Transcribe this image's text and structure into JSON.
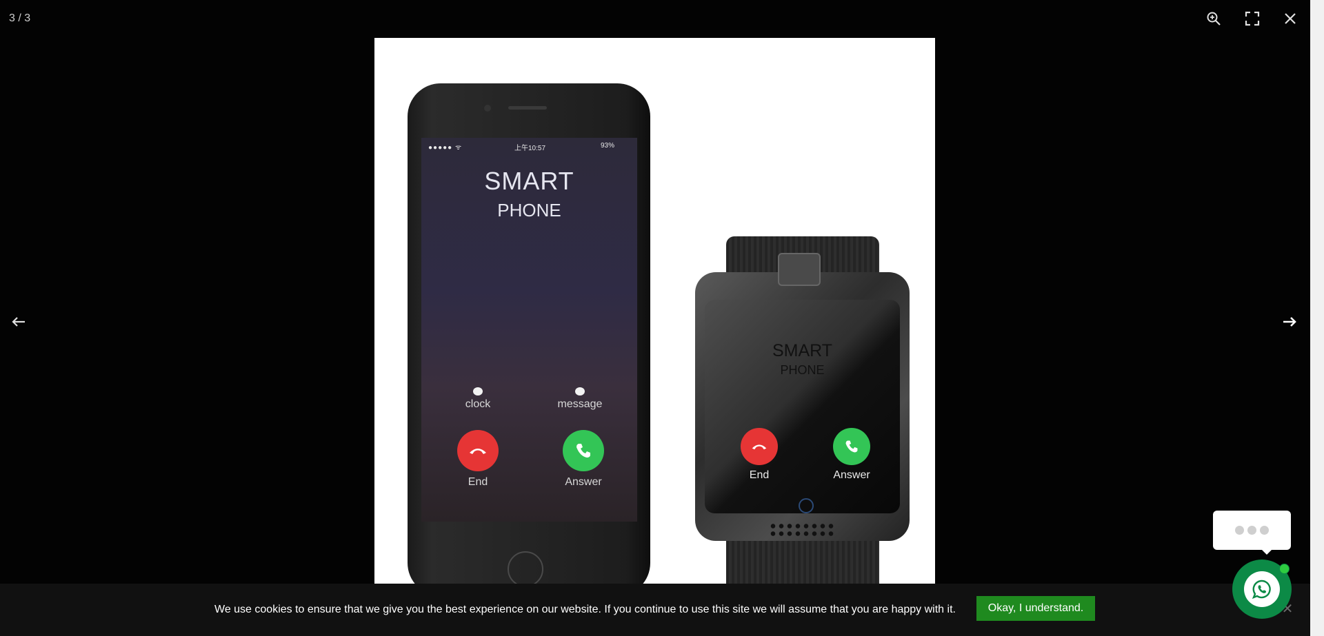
{
  "viewer": {
    "counter": "3 / 3",
    "toolbar": {
      "zoom": "zoom-in-icon",
      "fullscreen": "fullscreen-icon",
      "close": "close-icon"
    },
    "nav": {
      "prev": "arrow-left-icon",
      "next": "arrow-right-icon"
    }
  },
  "slide": {
    "phone": {
      "status_time": "上午10:57",
      "status_battery": "93%",
      "title": "SMART",
      "subtitle": "PHONE",
      "clock_label": "clock",
      "message_label": "message",
      "end_label": "End",
      "answer_label": "Answer"
    },
    "watch": {
      "title": "SMART",
      "subtitle": "PHONE",
      "end_label": "End",
      "answer_label": "Answer"
    }
  },
  "cookie_bar": {
    "text": "We use cookies to ensure that we give you the best experience on our website. If you continue to use this site we will assume that you are happy with it.",
    "accept_label": "Okay, I understand.",
    "close_glyph": "✕"
  },
  "chat": {
    "launcher_icon": "whatsapp-icon",
    "status_color": "#2ecc40",
    "accent_color": "#0c8a46"
  },
  "colors": {
    "overlay_bg": "#030303",
    "accept_button": "#1f8a1f"
  }
}
